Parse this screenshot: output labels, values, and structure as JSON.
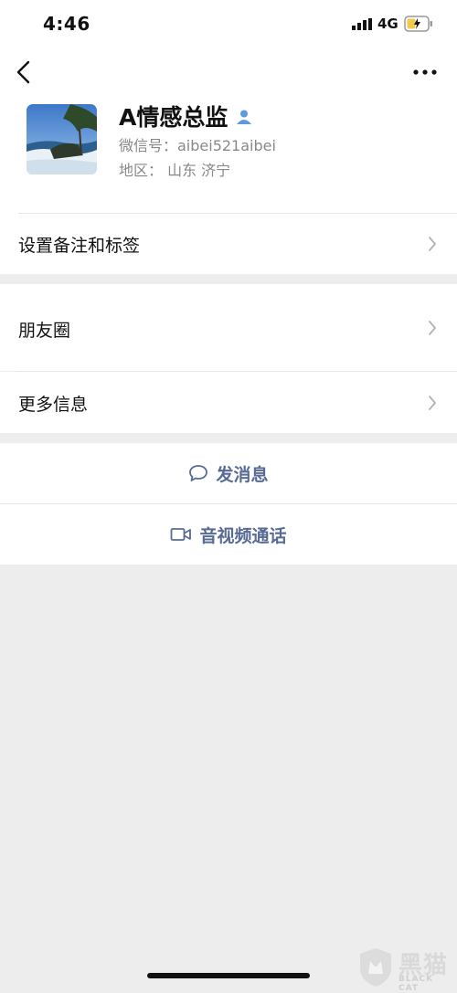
{
  "status": {
    "time": "4:46",
    "network": "4G"
  },
  "profile": {
    "name": "A情感总监",
    "wechat_id": "微信号：aibei521aibei",
    "region": "地区： 山东 济宁"
  },
  "menu": {
    "remark_tags": "设置备注和标签",
    "moments": "朋友圈",
    "more_info": "更多信息"
  },
  "actions": {
    "message": "发消息",
    "av_call": "音视频通话"
  },
  "watermark": {
    "text": "黑猫",
    "sub": "BLACK CAT"
  },
  "colors": {
    "link": "#576b95",
    "background": "#ededed"
  }
}
